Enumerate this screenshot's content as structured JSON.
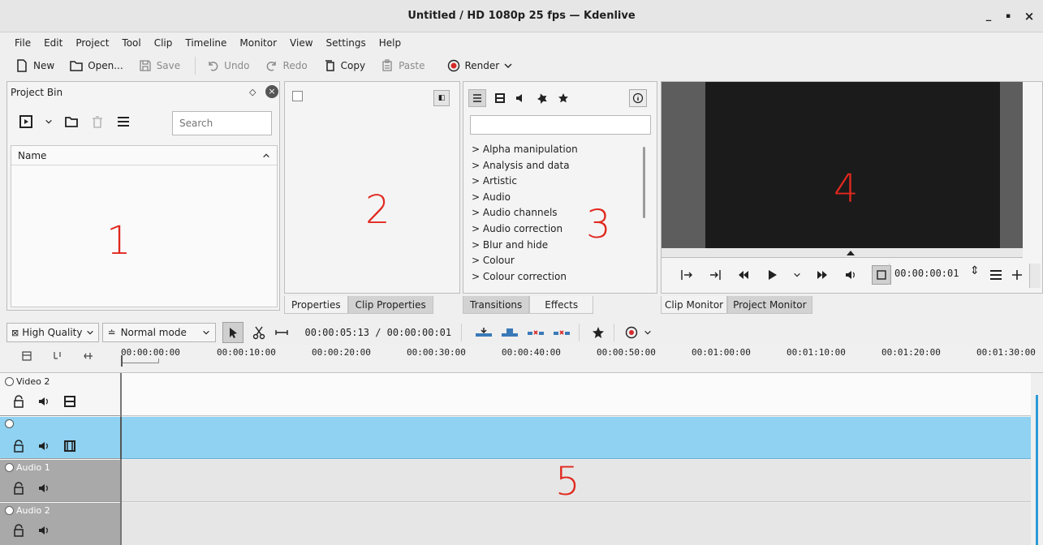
{
  "window": {
    "title": "Untitled / HD 1080p 25 fps — Kdenlive",
    "controls": [
      "_",
      "▪",
      "×"
    ]
  },
  "menu": [
    "File",
    "Edit",
    "Project",
    "Tool",
    "Clip",
    "Timeline",
    "Monitor",
    "View",
    "Settings",
    "Help"
  ],
  "toolbar": {
    "new": "New",
    "open": "Open...",
    "save": "Save",
    "undo": "Undo",
    "redo": "Redo",
    "copy": "Copy",
    "paste": "Paste",
    "render": "Render"
  },
  "project_bin": {
    "title": "Project Bin",
    "search_placeholder": "Search",
    "column_name": "Name"
  },
  "properties_tabs": [
    "Properties",
    "Clip Properties"
  ],
  "effects": {
    "categories": [
      "Alpha manipulation",
      "Analysis and data",
      "Artistic",
      "Audio",
      "Audio channels",
      "Audio correction",
      "Blur and hide",
      "Colour",
      "Colour correction"
    ],
    "tabs": [
      "Transitions",
      "Effects"
    ]
  },
  "monitor": {
    "timecode": "00:00:00:01",
    "tabs": [
      "Clip Monitor",
      "Project Monitor"
    ]
  },
  "timeline_toolbar": {
    "quality": "High Quality",
    "mode": "Normal mode",
    "position": "00:00:05:13 / 00:00:00:01"
  },
  "ruler": [
    "00:00:00:00",
    "00:00:10:00",
    "00:00:20:00",
    "00:00:30:00",
    "00:00:40:00",
    "00:00:50:00",
    "00:01:00:00",
    "00:01:10:00",
    "00:01:20:00",
    "00:01:30:00"
  ],
  "tracks": [
    {
      "name": "Video 2",
      "type": "video"
    },
    {
      "name": "",
      "type": "video",
      "selected": true
    },
    {
      "name": "Audio 1",
      "type": "audio"
    },
    {
      "name": "Audio 2",
      "type": "audio"
    }
  ],
  "annotations": [
    "1",
    "2",
    "3",
    "4",
    "5"
  ],
  "colors": {
    "selected_track": "#8fd2f2",
    "annotation": "#e0281e",
    "render_dot": "#d62b2b",
    "scrollbar": "#2b9ad8"
  }
}
